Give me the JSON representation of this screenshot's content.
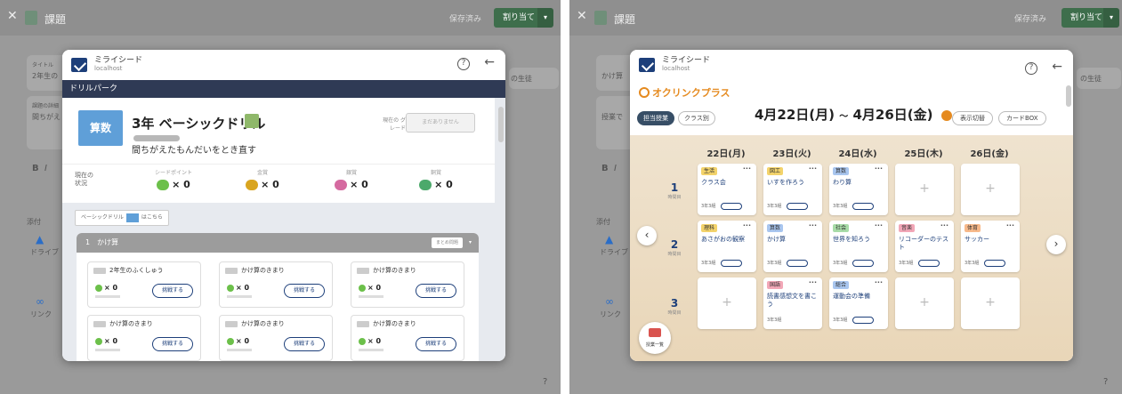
{
  "colors": {
    "drill_bar": "#2f3a55",
    "subject": "#5f9fd8",
    "brand_orange": "#e58a1f",
    "navy": "#1d3f7a",
    "assign_green": "#3e6e4c"
  },
  "left": {
    "window": {
      "close_icon": "close-icon",
      "title": "課題",
      "saved": "保存済み",
      "assign": "割り当て"
    },
    "bg": {
      "title_label": "タイトル",
      "title_value": "2年生の",
      "desc_label": "課題の詳細",
      "desc_value": "間ちがえ",
      "attach": "添付",
      "drive": "ドライブ",
      "link": "リンク",
      "generate": "の生徒"
    },
    "app": {
      "name": "ミライシード",
      "host": "localhost"
    },
    "drill": {
      "bar": "ドリルパーク",
      "subject": "算数",
      "title": "3年 ベーシックドリル",
      "subtitle": "間ちがえたもんだいをとき直す",
      "grade_label": "現在の\nグレード",
      "grade_btn": "まだありません",
      "status_label": "現在の\n状況",
      "stats": [
        {
          "caption": "シードポイント",
          "value": "× 0",
          "color": "#6cc04a"
        },
        {
          "caption": "金賞",
          "value": "× 0",
          "color": "#d9a520"
        },
        {
          "caption": "銀賞",
          "value": "× 0",
          "color": "#d56aa0"
        },
        {
          "caption": "銅賞",
          "value": "× 0",
          "color": "#4ca96b"
        }
      ],
      "link_text_1": "ベーシックドリル",
      "link_text_2": "はこちら",
      "unit": {
        "title": "1　かけ算",
        "btn": "まとめ問題",
        "cards": [
          {
            "name": "2年生のふくしゅう",
            "value": "× 0",
            "btn": "挑戦する"
          },
          {
            "name": "かけ算のきまり",
            "value": "× 0",
            "btn": "挑戦する"
          },
          {
            "name": "かけ算のきまり",
            "value": "× 0",
            "btn": "挑戦する"
          },
          {
            "name": "かけ算のきまり",
            "value": "× 0",
            "btn": "挑戦する"
          },
          {
            "name": "かけ算のきまり",
            "value": "× 0",
            "btn": "挑戦する"
          },
          {
            "name": "かけ算のきまり",
            "value": "× 0",
            "btn": "挑戦する"
          }
        ]
      }
    }
  },
  "right": {
    "window": {
      "title": "課題",
      "saved": "保存済み",
      "assign": "割り当て"
    },
    "bg": {
      "title_value": "かけ算",
      "desc_value": "授業で",
      "attach": "添付",
      "drive": "ドライブ",
      "link": "リンク",
      "generate": "の生徒"
    },
    "app": {
      "name": "ミライシード",
      "host": "localhost"
    },
    "oku": {
      "logo": "オクリンクプラス",
      "tabs": [
        "担当授業",
        "クラス別"
      ],
      "date_from": "4月22日(月)",
      "date_to": "4月26日(金)",
      "date_sep": "～",
      "switch": "表示切替",
      "cardbox": "カードBOX",
      "days": [
        "22日(月)",
        "23日(火)",
        "24日(水)",
        "25日(木)",
        "26日(金)"
      ],
      "periods": [
        {
          "n": "1",
          "t": "時間目"
        },
        {
          "n": "2",
          "t": "時間目"
        },
        {
          "n": "3",
          "t": "時間目"
        }
      ],
      "cells": [
        {
          "badge": "生活",
          "color": "#f3d36b",
          "name": "クラス会",
          "cls": "3年3組"
        },
        {
          "badge": "図工",
          "color": "#f3d36b",
          "name": "いすを作ろう",
          "cls": "3年3組"
        },
        {
          "badge": "算数",
          "color": "#a9c6ef",
          "name": "わり算",
          "cls": "3年3組"
        },
        {
          "badge": "理科",
          "color": "#f3d36b",
          "name": "あさがおの観察",
          "cls": "3年3組"
        },
        {
          "badge": "算数",
          "color": "#a9c6ef",
          "name": "かけ算",
          "cls": "3年3組"
        },
        {
          "badge": "社会",
          "color": "#a8dca8",
          "name": "世界を知ろう",
          "cls": "3年3組"
        },
        {
          "badge": "音楽",
          "color": "#f2a7b7",
          "name": "リコーダーのテスト",
          "cls": "3年3組"
        },
        {
          "badge": "体育",
          "color": "#f7b98a",
          "name": "サッカー",
          "cls": "3年3組"
        },
        {
          "badge": "国語",
          "color": "#f2a7b7",
          "name": "読書感想文を書こう",
          "cls": "3年3組"
        },
        {
          "badge": "総合",
          "color": "#a9c6ef",
          "name": "運動会の準備",
          "cls": "3年3組"
        }
      ],
      "lesson_list": "授業一覧"
    }
  }
}
